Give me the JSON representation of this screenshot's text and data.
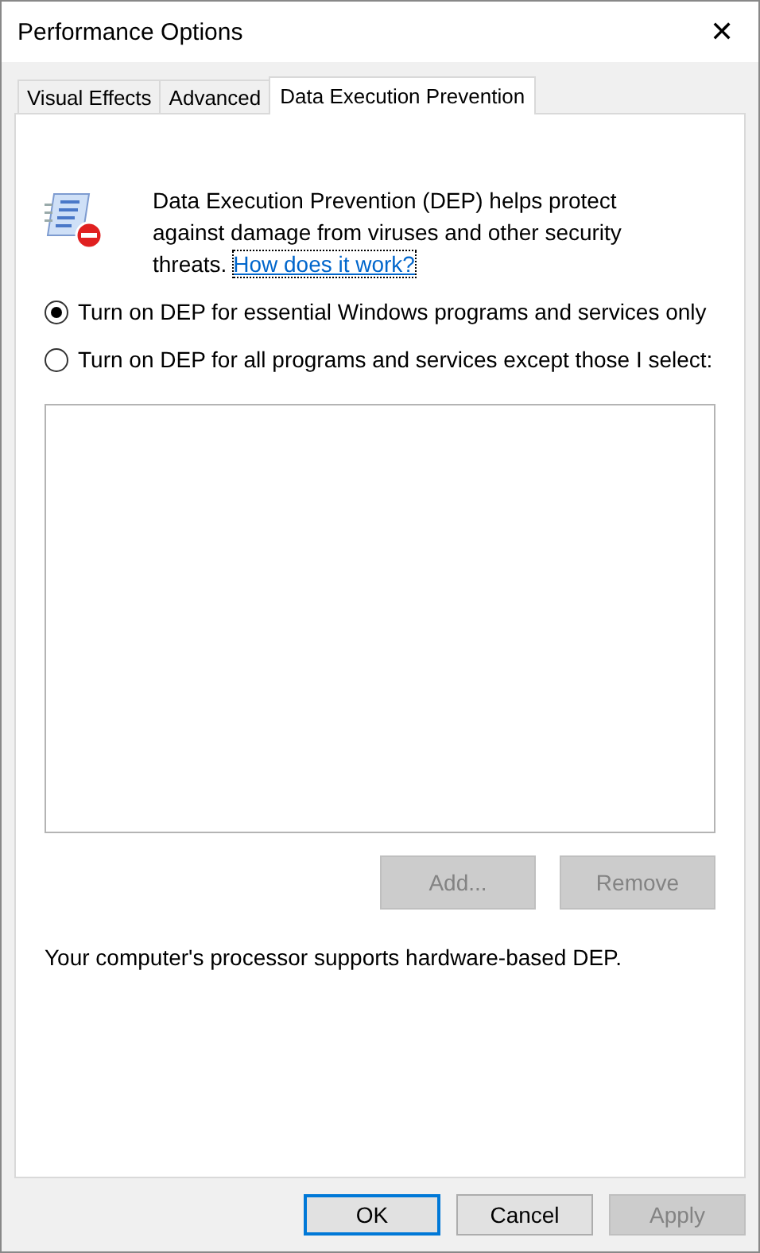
{
  "window": {
    "title": "Performance Options",
    "close": "✕"
  },
  "tabs": [
    {
      "label": "Visual Effects",
      "selected": false
    },
    {
      "label": "Advanced",
      "selected": false
    },
    {
      "label": "Data Execution Prevention",
      "selected": true
    }
  ],
  "intro": {
    "text": "Data Execution Prevention (DEP) helps protect against damage from viruses and other security threats.",
    "link": "How does it work?"
  },
  "options": [
    {
      "label": "Turn on DEP for essential Windows programs and services only",
      "selected": true
    },
    {
      "label": "Turn on DEP for all programs and services except those I select:",
      "selected": false
    }
  ],
  "list_buttons": [
    {
      "label": "Add...",
      "disabled": true
    },
    {
      "label": "Remove",
      "disabled": true
    }
  ],
  "status": "Your computer's processor supports hardware-based DEP.",
  "buttons": [
    {
      "label": "OK",
      "default": true,
      "disabled": false
    },
    {
      "label": "Cancel",
      "default": false,
      "disabled": false
    },
    {
      "label": "Apply",
      "default": false,
      "disabled": true
    }
  ]
}
